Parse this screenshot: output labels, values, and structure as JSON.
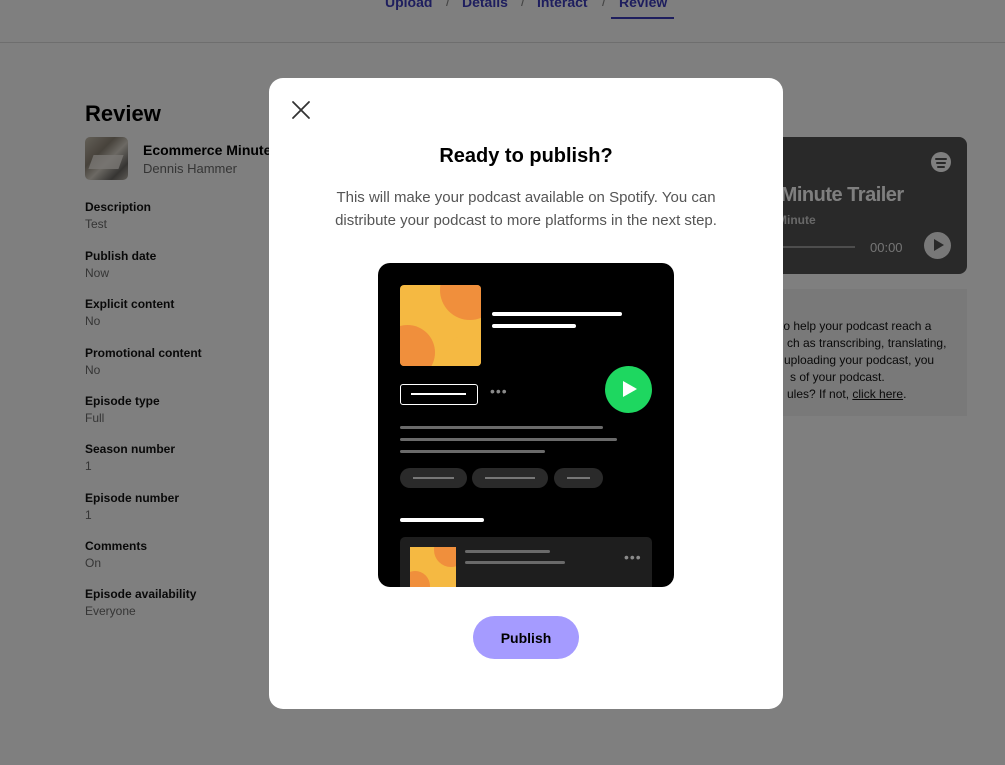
{
  "breadcrumb": {
    "steps": [
      "Upload",
      "Details",
      "Interact",
      "Review"
    ],
    "active": "Review"
  },
  "review": {
    "title": "Review",
    "show_title": "Ecommerce Minute",
    "author": "Dennis Hammer",
    "fields": [
      {
        "label": "Description",
        "value": "Test"
      },
      {
        "label": "Publish date",
        "value": "Now"
      },
      {
        "label": "Explicit content",
        "value": "No"
      },
      {
        "label": "Promotional content",
        "value": "No"
      },
      {
        "label": "Episode type",
        "value": "Full"
      },
      {
        "label": "Season number",
        "value": "1"
      },
      {
        "label": "Episode number",
        "value": "1"
      },
      {
        "label": "Comments",
        "value": "On"
      },
      {
        "label": "Episode availability",
        "value": "Everyone"
      }
    ]
  },
  "player": {
    "title": "e Minute Trailer",
    "subtitle": "Minute",
    "time": "00:00",
    "logo_icon": "spotify-icon"
  },
  "info_box": {
    "lines": [
      "to help your podcast reach a",
      "ch as transcribing, translating,",
      "uploading your podcast, you",
      "s of your podcast."
    ],
    "last_line_prefix": "ules? If not, ",
    "link_text": "click here",
    "last_line_suffix": "."
  },
  "modal": {
    "close_icon": "close-icon",
    "title": "Ready to publish?",
    "description": "This will make your podcast available on Spotify. You can distribute your podcast to more platforms in the next step.",
    "publish_label": "Publish"
  },
  "colors": {
    "accent": "#3d3dbd",
    "publish_button": "#a59bff",
    "spotify_green": "#1ed760",
    "overlay": "rgba(0,0,0,0.5)"
  }
}
